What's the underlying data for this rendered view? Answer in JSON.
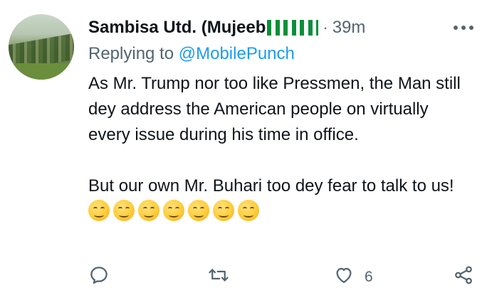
{
  "tweet": {
    "author_name": "Sambisa Utd. (Mujeeb",
    "separator": "·",
    "time": "39m",
    "more_icon": "more-horizontal-icon",
    "reply_prefix": "Replying to ",
    "reply_handle": "@MobilePunch",
    "paragraph_1": "As Mr. Trump nor too like Pressmen, the Man still dey address the American people on virtually every issue during his time in office.",
    "paragraph_2": "But our own Mr. Buhari too dey fear to talk to us!",
    "emoji_name": "smirking-face",
    "emoji_count": 7
  },
  "actions": {
    "reply_icon": "reply-icon",
    "retweet_icon": "retweet-icon",
    "like_icon": "heart-icon",
    "like_count": "6",
    "share_icon": "share-icon"
  },
  "colors": {
    "text": "#0f1419",
    "muted": "#536471",
    "link": "#1d9bf0",
    "flag_green": "#0a8f3a"
  }
}
